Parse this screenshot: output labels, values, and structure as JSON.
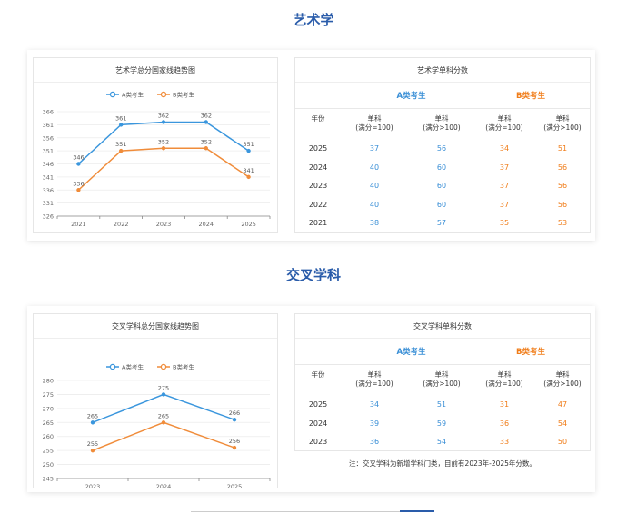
{
  "sections": [
    {
      "title": "艺术学",
      "chart_title": "艺术学总分国家线趋势图",
      "table_title": "艺术学单科分数",
      "group_a": "A类考生",
      "group_b": "B类考生",
      "col_year": "年份",
      "col_single_100": "单科\n(满分=100)",
      "col_single_gt100": "单科\n(满分>100)",
      "rows": [
        {
          "year": "2025",
          "a100": "37",
          "a_gt": "56",
          "b100": "34",
          "b_gt": "51"
        },
        {
          "year": "2024",
          "a100": "40",
          "a_gt": "60",
          "b100": "37",
          "b_gt": "56"
        },
        {
          "year": "2023",
          "a100": "40",
          "a_gt": "60",
          "b100": "37",
          "b_gt": "56"
        },
        {
          "year": "2022",
          "a100": "40",
          "a_gt": "60",
          "b100": "37",
          "b_gt": "56"
        },
        {
          "year": "2021",
          "a100": "38",
          "a_gt": "57",
          "b100": "35",
          "b_gt": "53"
        }
      ],
      "note": ""
    },
    {
      "title": "交叉学科",
      "chart_title": "交叉学科总分国家线趋势图",
      "table_title": "交叉学科单科分数",
      "group_a": "A类考生",
      "group_b": "B类考生",
      "col_year": "年份",
      "col_single_100": "单科\n(满分=100)",
      "col_single_gt100": "单科\n(满分>100)",
      "rows": [
        {
          "year": "2025",
          "a100": "34",
          "a_gt": "51",
          "b100": "31",
          "b_gt": "47"
        },
        {
          "year": "2024",
          "a100": "39",
          "a_gt": "59",
          "b100": "36",
          "b_gt": "54"
        },
        {
          "year": "2023",
          "a100": "36",
          "a_gt": "54",
          "b100": "33",
          "b_gt": "50"
        }
      ],
      "note": "注：交叉学科为新增学科门类，目前有2023年-2025年分数。"
    }
  ],
  "colors": {
    "a": "#3a96dd",
    "b": "#f08c3a",
    "title": "#2a5caa"
  },
  "chart_data": [
    {
      "type": "line",
      "title": "艺术学总分国家线趋势图",
      "categories": [
        "2021",
        "2022",
        "2023",
        "2024",
        "2025"
      ],
      "series": [
        {
          "name": "A类考生",
          "values": [
            346,
            361,
            362,
            362,
            351
          ]
        },
        {
          "name": "B类考生",
          "values": [
            336,
            351,
            352,
            352,
            341
          ]
        }
      ],
      "yticks": [
        326,
        331,
        336,
        341,
        346,
        351,
        356,
        361,
        366
      ],
      "ylim": [
        326,
        366
      ],
      "grid": true,
      "legend": "top-center"
    },
    {
      "type": "line",
      "title": "交叉学科总分国家线趋势图",
      "categories": [
        "2023",
        "2024",
        "2025"
      ],
      "series": [
        {
          "name": "A类考生",
          "values": [
            265,
            275,
            266
          ]
        },
        {
          "name": "B类考生",
          "values": [
            255,
            265,
            256
          ]
        }
      ],
      "yticks": [
        245,
        250,
        255,
        260,
        265,
        270,
        275,
        280
      ],
      "ylim": [
        245,
        280
      ],
      "grid": true,
      "legend": "top-center"
    }
  ]
}
